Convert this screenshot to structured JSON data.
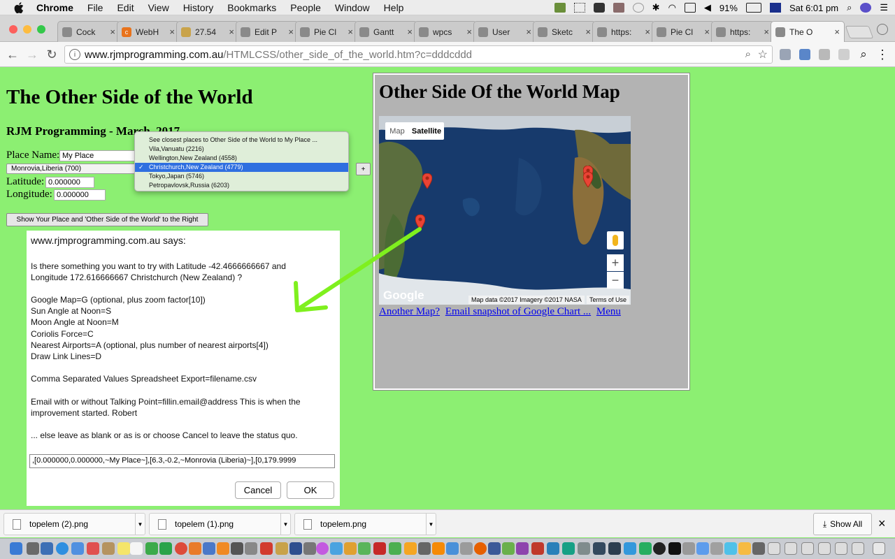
{
  "menubar": {
    "app": "Chrome",
    "items": [
      "File",
      "Edit",
      "View",
      "History",
      "Bookmarks",
      "People",
      "Window",
      "Help"
    ],
    "battery": "91%",
    "clock": "Sat 6:01 pm"
  },
  "tabs": [
    {
      "label": "Cock"
    },
    {
      "label": "WebH"
    },
    {
      "label": "27.54"
    },
    {
      "label": "Edit P"
    },
    {
      "label": "Pie Cl"
    },
    {
      "label": "Gantt"
    },
    {
      "label": "wpcs"
    },
    {
      "label": "User"
    },
    {
      "label": "Sketc"
    },
    {
      "label": "https:"
    },
    {
      "label": "Pie Cl"
    },
    {
      "label": "https:"
    },
    {
      "label": "The O"
    }
  ],
  "address": {
    "domain": "www.rjmprogramming.com.au",
    "path": "/HTMLCSS/other_side_of_the_world.htm?c=dddcddd"
  },
  "page": {
    "title": "The Other Side of the World",
    "subtitle": "RJM Programming - March, 2017",
    "place_label": "Place Name:",
    "place_value": "My Place",
    "place_select": "Monrovia,Liberia (700)",
    "latitude_label": "Latitude:",
    "latitude_value": "0.000000",
    "longitude_label": "Longitude:",
    "longitude_value": "0.000000",
    "plus_button": "+",
    "show_button": "Show Your Place and 'Other Side of the World' to the Right"
  },
  "dropdown": {
    "options": [
      "See closest places to Other Side of the World to My Place ...",
      "Vila,Vanuatu (2216)",
      "Wellington,New Zealand (4558)",
      "Christchurch,New Zealand (4779)",
      "Tokyo,Japan (5746)",
      "Petropavlovsk,Russia (6203)"
    ],
    "selected": "Christchurch,New Zealand (4779)"
  },
  "dialog": {
    "title": "www.rjmprogramming.com.au says:",
    "lines": [
      "Is there something you want to try with Latitude -42.4666666667 and",
      "Longitude 172.616666667 Christchurch (New Zealand) ?",
      "Google Map=G (optional, plus zoom factor[10])",
      "Sun Angle at Noon=S",
      "Moon Angle at Noon=M",
      "Coriolis Force=C",
      "Nearest Airports=A (optional, plus number of nearest airports[4])",
      "Draw Link Lines=D",
      "Comma Separated Values Spreadsheet Export=filename.csv",
      "Email with or without Talking Point=fillin.email@address This is when the",
      "improvement started.  Robert",
      "...  else leave as blank or as is or choose Cancel to leave the status quo."
    ],
    "input_value": ",[0.000000,0.000000,~My Place~],[6.3,-0.2,~Monrovia (Liberia)~],[0,179.9999",
    "cancel": "Cancel",
    "ok": "OK"
  },
  "panel": {
    "title": "Other Side Of the World Map",
    "map_tab": "Map",
    "satellite_tab": "Satellite",
    "zoom_in": "+",
    "zoom_out": "−",
    "google": "Google",
    "attribution": "Map data ©2017 Imagery ©2017 NASA",
    "terms": "Terms of Use",
    "link1": "Another Map?",
    "link2": "Email snapshot of Google Chart ...",
    "link3": "Menu"
  },
  "downloads": {
    "items": [
      "topelem (2).png",
      "topelem (1).png",
      "topelem.png"
    ],
    "show_all": "Show All",
    "close": "×"
  },
  "colors": {
    "page_bg": "#8cef72",
    "panel_bg": "#b3b3b3",
    "arrow": "#7ff01e",
    "select_highlight": "#2f6fe0"
  }
}
